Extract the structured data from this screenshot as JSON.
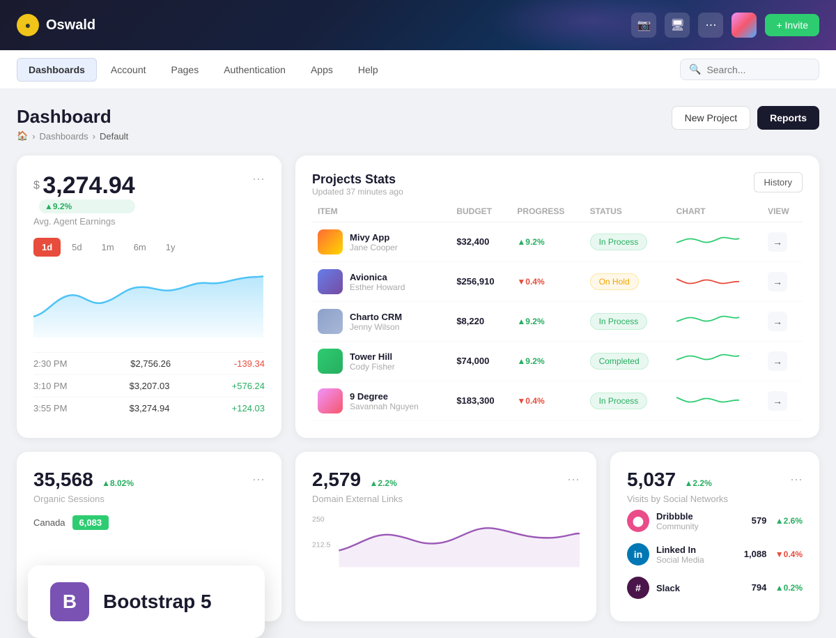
{
  "header": {
    "logo_text": "Oswald",
    "invite_label": "+ Invite",
    "icons": [
      "camera",
      "screen",
      "share"
    ]
  },
  "nav": {
    "items": [
      {
        "label": "Dashboards",
        "active": true
      },
      {
        "label": "Account",
        "active": false
      },
      {
        "label": "Pages",
        "active": false
      },
      {
        "label": "Authentication",
        "active": false
      },
      {
        "label": "Apps",
        "active": false
      },
      {
        "label": "Help",
        "active": false
      }
    ],
    "search_placeholder": "Search..."
  },
  "page": {
    "title": "Dashboard",
    "breadcrumb": [
      "home",
      "Dashboards",
      "Default"
    ],
    "btn_new_project": "New Project",
    "btn_reports": "Reports"
  },
  "earnings_card": {
    "currency": "$",
    "amount": "3,274.94",
    "badge": "▲9.2%",
    "label": "Avg. Agent Earnings",
    "time_tabs": [
      "1d",
      "5d",
      "1m",
      "6m",
      "1y"
    ],
    "active_tab": "1d",
    "rows": [
      {
        "time": "2:30 PM",
        "value": "$2,756.26",
        "change": "-139.34",
        "positive": false
      },
      {
        "time": "3:10 PM",
        "value": "$3,207.03",
        "change": "+576.24",
        "positive": true
      },
      {
        "time": "3:55 PM",
        "value": "$3,274.94",
        "change": "+124.03",
        "positive": true
      }
    ]
  },
  "projects_card": {
    "title": "Projects Stats",
    "updated": "Updated 37 minutes ago",
    "history_btn": "History",
    "columns": [
      "ITEM",
      "BUDGET",
      "PROGRESS",
      "STATUS",
      "CHART",
      "VIEW"
    ],
    "rows": [
      {
        "name": "Mivy App",
        "person": "Jane Cooper",
        "budget": "$32,400",
        "progress": "▲9.2%",
        "progress_up": true,
        "status": "In Process",
        "status_type": "inprocess",
        "color1": "#ff6b35",
        "color2": "#ffd700"
      },
      {
        "name": "Avionica",
        "person": "Esther Howard",
        "budget": "$256,910",
        "progress": "▼0.4%",
        "progress_up": false,
        "status": "On Hold",
        "status_type": "onhold",
        "color1": "#667eea",
        "color2": "#764ba2"
      },
      {
        "name": "Charto CRM",
        "person": "Jenny Wilson",
        "budget": "$8,220",
        "progress": "▲9.2%",
        "progress_up": true,
        "status": "In Process",
        "status_type": "inprocess",
        "color1": "#8ca0c8",
        "color2": "#a8b8d8"
      },
      {
        "name": "Tower Hill",
        "person": "Cody Fisher",
        "budget": "$74,000",
        "progress": "▲9.2%",
        "progress_up": true,
        "status": "Completed",
        "status_type": "completed",
        "color1": "#2ecc71",
        "color2": "#27ae60"
      },
      {
        "name": "9 Degree",
        "person": "Savannah Nguyen",
        "budget": "$183,300",
        "progress": "▼0.4%",
        "progress_up": false,
        "status": "In Process",
        "status_type": "inprocess",
        "color1": "#f093fb",
        "color2": "#f5576c"
      }
    ]
  },
  "organic_sessions": {
    "value": "35,568",
    "badge": "▲8.02%",
    "label": "Organic Sessions",
    "country": "Canada",
    "country_value": "6,083"
  },
  "domain_links": {
    "value": "2,579",
    "badge": "▲2.2%",
    "label": "Domain External Links",
    "chart_max": 250,
    "chart_mid": 212.5
  },
  "social_networks": {
    "value": "5,037",
    "badge": "▲2.2%",
    "label": "Visits by Social Networks",
    "items": [
      {
        "name": "Dribbble",
        "type": "Community",
        "value": "579",
        "change": "▲2.6%",
        "up": true,
        "color": "#ea4c89"
      },
      {
        "name": "Linked In",
        "type": "Social Media",
        "value": "1,088",
        "change": "▼0.4%",
        "up": false,
        "color": "#0077b5"
      },
      {
        "name": "Slack",
        "type": "",
        "value": "794",
        "change": "▲0.2%",
        "up": true,
        "color": "#4a154b"
      }
    ]
  },
  "bootstrap_promo": {
    "icon": "B",
    "text": "Bootstrap 5"
  }
}
